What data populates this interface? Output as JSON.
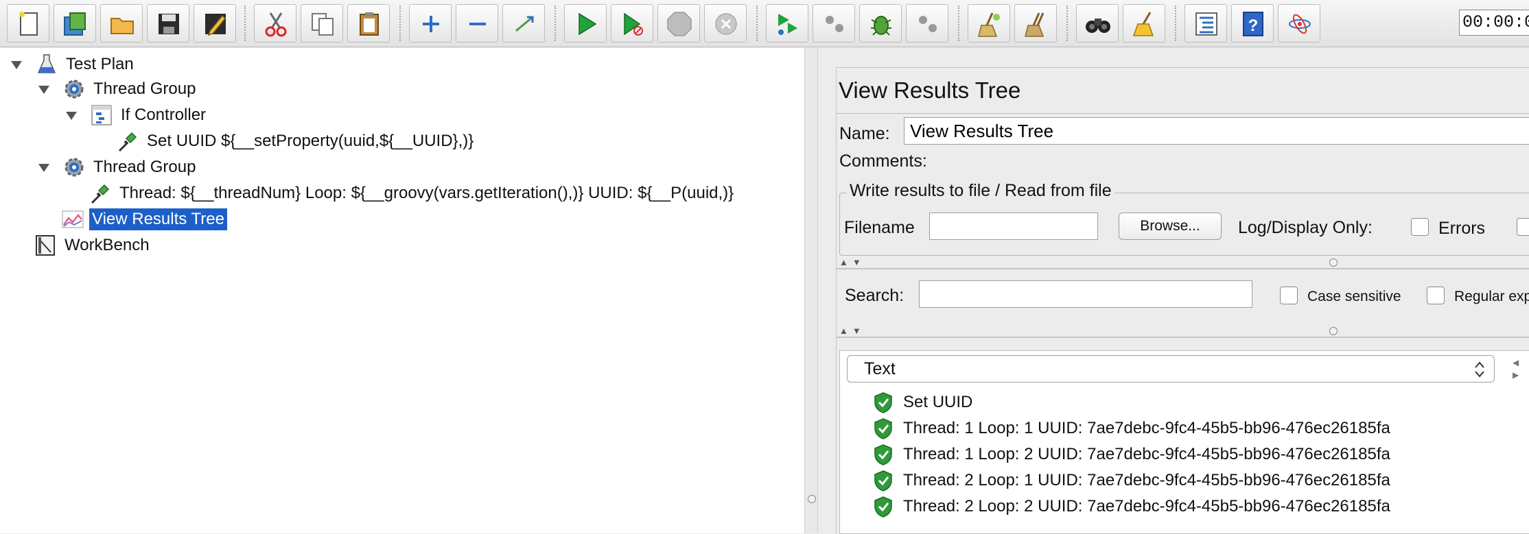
{
  "toolbar": {
    "buttons": [
      {
        "name": "new-icon"
      },
      {
        "name": "templates-icon"
      },
      {
        "name": "open-icon"
      },
      {
        "name": "save-icon"
      },
      {
        "name": "save-as-icon"
      },
      {
        "name": "cut-icon"
      },
      {
        "name": "copy-icon"
      },
      {
        "name": "paste-icon"
      },
      {
        "name": "expand-icon"
      },
      {
        "name": "collapse-icon"
      },
      {
        "name": "toggle-icon"
      },
      {
        "name": "start-icon"
      },
      {
        "name": "start-no-pauses-icon"
      },
      {
        "name": "stop-icon"
      },
      {
        "name": "shutdown-icon"
      },
      {
        "name": "remote-start-icon"
      },
      {
        "name": "remote-start-all-icon"
      },
      {
        "name": "remote-stop-icon"
      },
      {
        "name": "remote-shutdown-icon"
      },
      {
        "name": "clear-icon"
      },
      {
        "name": "clear-all-icon"
      },
      {
        "name": "search-icon"
      },
      {
        "name": "reset-search-icon"
      },
      {
        "name": "function-helper-icon"
      },
      {
        "name": "help-icon"
      },
      {
        "name": "remote-exit-icon"
      }
    ],
    "timer": "00:00:0"
  },
  "tree": {
    "items": [
      {
        "label": "Test Plan",
        "icon": "test-plan-icon"
      },
      {
        "label": "Thread Group",
        "icon": "thread-group-icon"
      },
      {
        "label": "If Controller",
        "icon": "if-controller-icon"
      },
      {
        "label": "Set UUID ${__setProperty(uuid,${__UUID},)}",
        "icon": "sampler-icon"
      },
      {
        "label": "Thread Group",
        "icon": "thread-group-icon"
      },
      {
        "label": "Thread: ${__threadNum} Loop: ${__groovy(vars.getIteration(),)} UUID: ${__P(uuid,)}",
        "icon": "sampler-icon"
      },
      {
        "label": "View Results Tree",
        "icon": "listener-icon",
        "selected": true
      },
      {
        "label": "WorkBench",
        "icon": "workbench-icon"
      }
    ]
  },
  "panel": {
    "title": "View Results Tree",
    "name_label": "Name:",
    "name_value": "View Results Tree",
    "comments_label": "Comments:",
    "file_group_title": "Write results to file / Read from file",
    "filename_label": "Filename",
    "filename_value": "",
    "browse_label": "Browse...",
    "log_display_label": "Log/Display Only:",
    "errors_label": "Errors",
    "search_label": "Search:",
    "search_value": "",
    "case_sensitive_label": "Case sensitive",
    "regex_label": "Regular exp",
    "renderer": "Text"
  },
  "results": [
    {
      "label": "Set UUID",
      "status": "success"
    },
    {
      "label": "Thread: 1 Loop: 1 UUID: 7ae7debc-9fc4-45b5-bb96-476ec26185fa",
      "status": "success"
    },
    {
      "label": "Thread: 1 Loop: 2 UUID: 7ae7debc-9fc4-45b5-bb96-476ec26185fa",
      "status": "success"
    },
    {
      "label": "Thread: 2 Loop: 1 UUID: 7ae7debc-9fc4-45b5-bb96-476ec26185fa",
      "status": "success"
    },
    {
      "label": "Thread: 2 Loop: 2 UUID: 7ae7debc-9fc4-45b5-bb96-476ec26185fa",
      "status": "success"
    }
  ],
  "colors": {
    "selection": "#1c5fc8",
    "success": "#2f9a3a"
  }
}
